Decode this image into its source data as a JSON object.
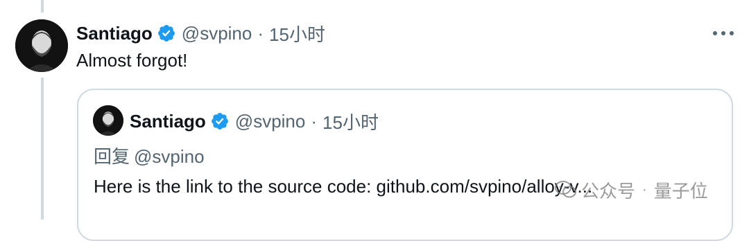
{
  "tweet": {
    "author_name": "Santiago",
    "handle": "@svpino",
    "separator": "·",
    "time": "15小时",
    "text": "Almost forgot!"
  },
  "quoted_tweet": {
    "author_name": "Santiago",
    "handle": "@svpino",
    "separator": "·",
    "time": "15小时",
    "reply_prefix": "回复",
    "reply_mention": "@svpino",
    "text": "Here is the link to the source code: github.com/svpino/alloy-v..."
  },
  "watermark": {
    "account": "公众号",
    "separator": "·",
    "brand": "量子位"
  },
  "colors": {
    "verified_blue": "#1d9bf0",
    "secondary_text": "#536471",
    "border": "#cfd9de"
  },
  "icons": {
    "verified": "verified-badge-icon",
    "more": "more-options-icon",
    "watermark": "wechat-icon"
  }
}
